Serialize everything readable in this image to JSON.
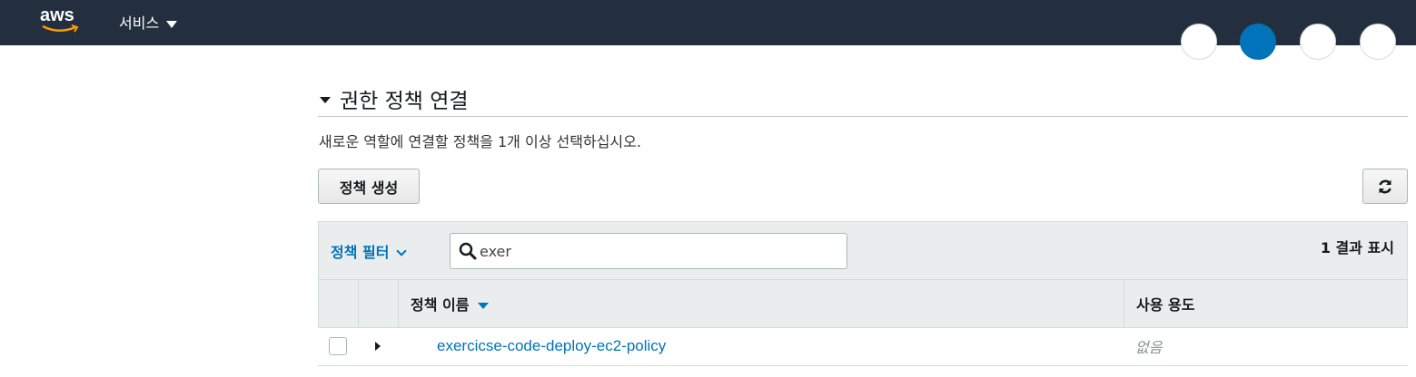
{
  "topnav": {
    "logo_text": "aws",
    "services_label": "서비스"
  },
  "section": {
    "title": "권한 정책 연결",
    "description": "새로운 역할에 연결할 정책을 1개 이상 선택하십시오."
  },
  "toolbar": {
    "create_policy_label": "정책 생성",
    "refresh_icon": "refresh-icon"
  },
  "filter": {
    "label": "정책 필터",
    "search_value": "exer",
    "result_count": "1 결과 표시"
  },
  "table": {
    "columns": [
      "정책 이름",
      "사용 용도"
    ],
    "rows": [
      {
        "name": "exercicse-code-deploy-ec2-policy",
        "usage": "없음"
      }
    ]
  },
  "colors": {
    "nav_bg": "#232f3e",
    "accent": "#0073bb",
    "logo_smile": "#ff9900"
  }
}
